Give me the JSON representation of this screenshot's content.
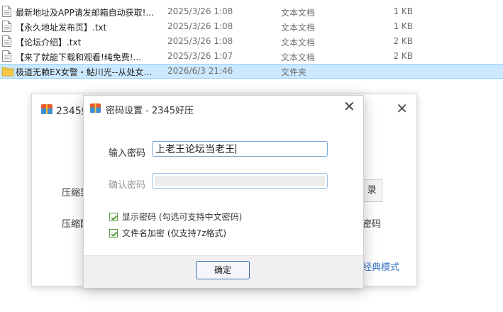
{
  "files": [
    {
      "name": "最新地址及APP请发邮箱自动获取!...",
      "date": "2025/3/26 1:08",
      "type": "文本文档",
      "size": "1 KB",
      "kind": "text-file-icon"
    },
    {
      "name": "【永久地址发布页】.txt",
      "date": "2025/3/26 1:08",
      "type": "文本文档",
      "size": "1 KB",
      "kind": "text-file-icon"
    },
    {
      "name": "【论坛介绍】.txt",
      "date": "2025/3/26 1:08",
      "type": "文本文档",
      "size": "2 KB",
      "kind": "text-file-icon"
    },
    {
      "name": "【来了就能下载和观看!纯免费!...",
      "date": "2025/3/26 1:07",
      "type": "文本文档",
      "size": "2 KB",
      "kind": "text-file-icon"
    },
    {
      "name": "极道无赖EX女警・鮎川光--从处女...",
      "date": "2026/6/3 21:46",
      "type": "文件夹",
      "size": "",
      "kind": "folder-icon"
    }
  ],
  "bg_window": {
    "title": "2345好压",
    "label_compress": "压缩到",
    "label_compress2": "压缩配",
    "browse_fragment": "录",
    "password_fragment": "密码",
    "classic_link": "经典模式"
  },
  "dialog": {
    "title": "密码设置 - 2345好压",
    "password_label": "输入密码",
    "password_value": "上老王论坛当老王",
    "confirm_label": "确认密码",
    "confirm_value": "",
    "show_password_label": "显示密码 (勾选可支持中文密码)",
    "show_password_checked": true,
    "encrypt_names_label": "文件名加密 (仅支持7z格式)",
    "encrypt_names_checked": true,
    "ok_label": "确定"
  },
  "colors": {
    "selection": "#cce8ff",
    "accent": "#3a74c6",
    "check_green": "#4c8f2e",
    "folder": "#f6c94a"
  }
}
